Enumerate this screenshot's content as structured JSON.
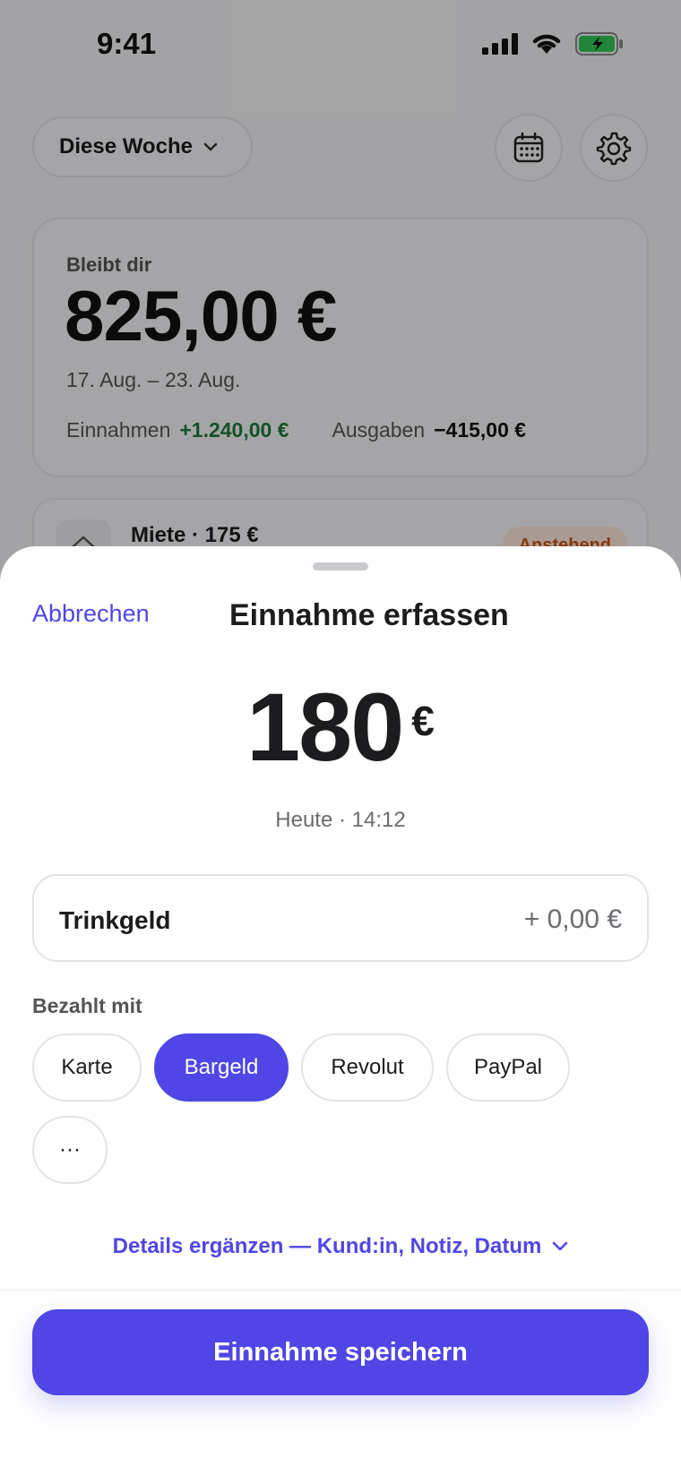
{
  "status_bar": {
    "time": "9:41"
  },
  "background": {
    "period_selector": "Diese Woche",
    "balance_card": {
      "label": "Bleibt dir",
      "amount": "825,00 €",
      "range": "17. Aug. – 23. Aug.",
      "income_label": "Einnahmen",
      "income_value": "+1.240,00 €",
      "expense_label": "Ausgaben",
      "expense_value": "−415,00 €"
    },
    "list_item": {
      "title": "Miete · 175 €",
      "badge": "Anstehend"
    }
  },
  "sheet": {
    "cancel_label": "Abbrechen",
    "title": "Einnahme erfassen",
    "amount": "180",
    "currency": "€",
    "timestamp": "Heute · 14:12",
    "tip": {
      "label": "Trinkgeld",
      "value": "+ 0,00 €"
    },
    "paid_with_label": "Bezahlt mit",
    "payment_methods": [
      {
        "label": "Karte",
        "selected": false
      },
      {
        "label": "Bargeld",
        "selected": true
      },
      {
        "label": "Revolut",
        "selected": false
      },
      {
        "label": "PayPal",
        "selected": false
      },
      {
        "label": "···",
        "selected": false
      }
    ],
    "details_link": "Details ergänzen — Kund:in, Notiz, Datum",
    "save_label": "Einnahme speichern"
  },
  "colors": {
    "accent": "#4f46e5",
    "income": "#1e7a3c",
    "badge": "#c8561a"
  }
}
